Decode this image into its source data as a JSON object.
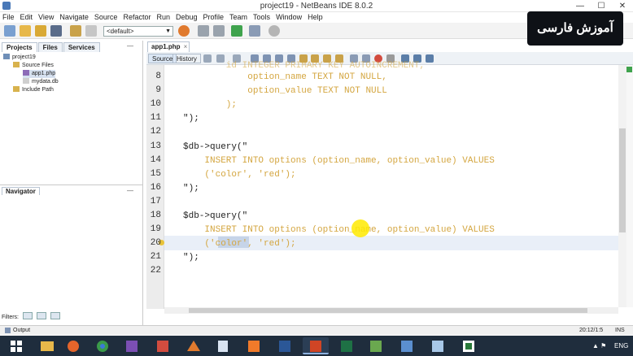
{
  "window": {
    "title": "project19 - NetBeans IDE 8.0.2",
    "min": "—",
    "max": "☐",
    "close": "✕"
  },
  "menu": [
    "File",
    "Edit",
    "View",
    "Navigate",
    "Source",
    "Refactor",
    "Run",
    "Debug",
    "Profile",
    "Team",
    "Tools",
    "Window",
    "Help"
  ],
  "toolbar": {
    "config": "<default>"
  },
  "left": {
    "tabs": [
      "Projects",
      "Files",
      "Services"
    ],
    "tree": {
      "project": "project19",
      "source_files": "Source Files",
      "file1": "app1.php",
      "file2": "mydata.db",
      "include_path": "Include Path"
    },
    "navigator": "Navigator",
    "filters": "Filters:"
  },
  "editor": {
    "file_tab": "app1.php",
    "tab_close": "×",
    "source_tab": "Source",
    "history_tab": "History",
    "lines": [
      {
        "n": "8",
        "parts": [
          {
            "t": "            ",
            "c": "p"
          },
          {
            "t": "option_name TEXT NOT NULL,",
            "c": "s"
          }
        ]
      },
      {
        "n": "9",
        "parts": [
          {
            "t": "            ",
            "c": "p"
          },
          {
            "t": "option_value TEXT NOT NULL",
            "c": "s"
          }
        ]
      },
      {
        "n": "10",
        "parts": [
          {
            "t": "        );",
            "c": "s"
          }
        ]
      },
      {
        "n": "11",
        "parts": [
          {
            "t": "\");",
            "c": "p"
          }
        ]
      },
      {
        "n": "12",
        "parts": []
      },
      {
        "n": "13",
        "parts": [
          {
            "t": "$db->query(\"",
            "c": "p"
          }
        ]
      },
      {
        "n": "14",
        "parts": [
          {
            "t": "    INSERT INTO options (option_name, option_value) VALUES",
            "c": "s"
          }
        ]
      },
      {
        "n": "15",
        "parts": [
          {
            "t": "    ('color', 'red');",
            "c": "s"
          }
        ]
      },
      {
        "n": "16",
        "parts": [
          {
            "t": "\");",
            "c": "p"
          }
        ]
      },
      {
        "n": "17",
        "parts": []
      },
      {
        "n": "18",
        "parts": [
          {
            "t": "$db->query(\"",
            "c": "p"
          }
        ]
      },
      {
        "n": "19",
        "parts": [
          {
            "t": "    INSERT INTO options (option_name, option_value) VALUES",
            "c": "s"
          }
        ]
      },
      {
        "n": "20",
        "parts": [
          {
            "t": "    ('color', 'red');",
            "c": "s"
          }
        ]
      },
      {
        "n": "21",
        "parts": [
          {
            "t": "\");",
            "c": "p"
          }
        ]
      },
      {
        "n": "22",
        "parts": []
      }
    ]
  },
  "status": {
    "output": "Output",
    "position": "20:12/1:5",
    "mode": "INS"
  },
  "taskbar": {
    "lang": "ENG"
  },
  "badge": "آموزش فارسی"
}
